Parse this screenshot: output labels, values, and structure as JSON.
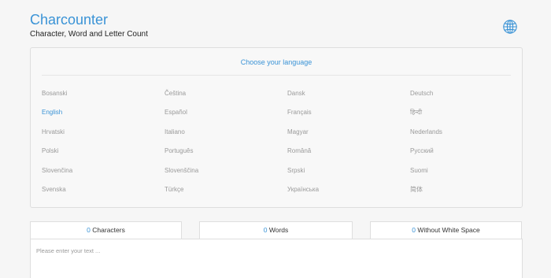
{
  "app": {
    "title": "Charcounter",
    "subtitle": "Character, Word and Letter Count"
  },
  "header_icon": "globe-icon",
  "language_panel": {
    "heading": "Choose your language",
    "selected": "English",
    "languages": [
      "Bosanski",
      "Čeština",
      "Dansk",
      "Deutsch",
      "English",
      "Español",
      "Français",
      "हिन्दी",
      "Hrvatski",
      "Italiano",
      "Magyar",
      "Nederlands",
      "Polski",
      "Português",
      "Română",
      "Русский",
      "Slovenčina",
      "Slovenščina",
      "Srpski",
      "Suomi",
      "Svenska",
      "Türkçe",
      "Українська",
      "简体"
    ]
  },
  "stats": {
    "characters": {
      "value": "0",
      "label": "Characters"
    },
    "words": {
      "value": "0",
      "label": "Words"
    },
    "without_white_space": {
      "value": "0",
      "label": "Without White Space"
    }
  },
  "editor": {
    "placeholder": "Please enter your text ..."
  },
  "colors": {
    "accent": "#3a93d6",
    "muted_text": "#9a9a9a",
    "background": "#f6f6f6"
  }
}
